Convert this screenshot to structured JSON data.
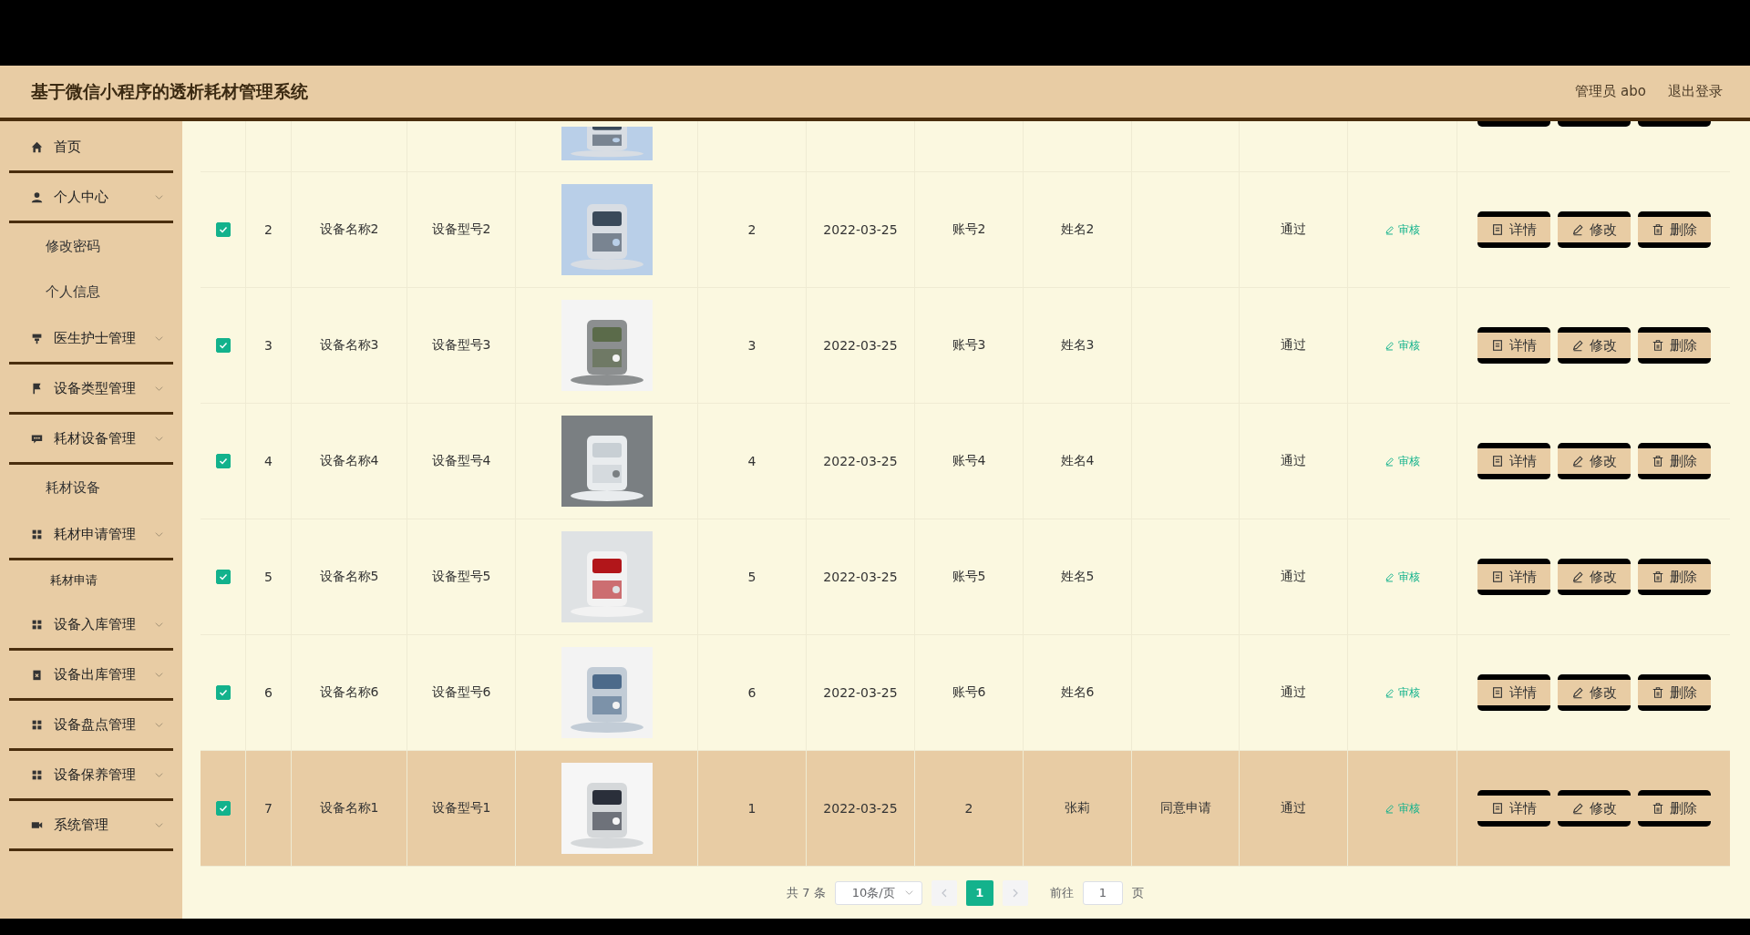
{
  "header": {
    "title": "基于微信小程序的透析耗材管理系统",
    "user": "管理员 abo",
    "logout": "退出登录"
  },
  "sidebar": {
    "items": [
      {
        "kind": "link",
        "label": "首页"
      },
      {
        "kind": "group",
        "label": "个人中心",
        "children": [
          {
            "label": "修改密码",
            "selected": false
          },
          {
            "label": "个人信息",
            "selected": false
          }
        ]
      },
      {
        "kind": "group",
        "label": "医生护士管理"
      },
      {
        "kind": "group",
        "label": "设备类型管理"
      },
      {
        "kind": "group",
        "label": "耗材设备管理",
        "children": [
          {
            "label": "耗材设备",
            "selected": false
          }
        ]
      },
      {
        "kind": "group",
        "label": "耗材申请管理",
        "children": [
          {
            "label": "耗材申请",
            "selected": true
          }
        ]
      },
      {
        "kind": "group",
        "label": "设备入库管理"
      },
      {
        "kind": "group",
        "label": "设备出库管理"
      },
      {
        "kind": "group",
        "label": "设备盘点管理"
      },
      {
        "kind": "group",
        "label": "设备保养管理"
      },
      {
        "kind": "group",
        "label": "系统管理"
      }
    ]
  },
  "table": {
    "rows": [
      {
        "kind": "partial"
      },
      {
        "kind": "item",
        "checked": true,
        "selected": false,
        "no": "2",
        "name": "设备名称2",
        "model": "设备型号2",
        "qty": "2",
        "date": "2022-03-25",
        "account": "账号2",
        "person": "姓名2",
        "status": "通过",
        "review": "审核",
        "actions": [
          "详情",
          "修改",
          "删除"
        ]
      },
      {
        "kind": "item",
        "checked": true,
        "selected": false,
        "no": "3",
        "name": "设备名称3",
        "model": "设备型号3",
        "qty": "3",
        "date": "2022-03-25",
        "account": "账号3",
        "person": "姓名3",
        "status": "通过",
        "review": "审核",
        "actions": [
          "详情",
          "修改",
          "删除"
        ]
      },
      {
        "kind": "item",
        "checked": true,
        "selected": false,
        "no": "4",
        "name": "设备名称4",
        "model": "设备型号4",
        "qty": "4",
        "date": "2022-03-25",
        "account": "账号4",
        "person": "姓名4",
        "status": "通过",
        "review": "审核",
        "actions": [
          "详情",
          "修改",
          "删除"
        ]
      },
      {
        "kind": "item",
        "checked": true,
        "selected": false,
        "no": "5",
        "name": "设备名称5",
        "model": "设备型号5",
        "qty": "5",
        "date": "2022-03-25",
        "account": "账号5",
        "person": "姓名5",
        "status": "通过",
        "review": "审核",
        "actions": [
          "详情",
          "修改",
          "删除"
        ]
      },
      {
        "kind": "item",
        "checked": true,
        "selected": false,
        "no": "6",
        "name": "设备名称6",
        "model": "设备型号6",
        "qty": "6",
        "date": "2022-03-25",
        "account": "账号6",
        "person": "姓名6",
        "status": "通过",
        "review": "审核",
        "actions": [
          "详情",
          "修改",
          "删除"
        ]
      },
      {
        "kind": "item",
        "checked": true,
        "selected": true,
        "no": "7",
        "name": "设备名称1",
        "model": "设备型号1",
        "qty": "1",
        "date": "2022-03-25",
        "account": "2",
        "person": "张莉",
        "column_10": "同意申请",
        "status": "通过",
        "review": "审核",
        "actions": [
          "详情",
          "修改",
          "删除"
        ]
      }
    ]
  },
  "pagination": {
    "total": "共 7 条",
    "page_size": "10条/页",
    "pages": [
      {
        "label": "1",
        "selected": true
      }
    ],
    "goto": "前往",
    "goto_value": "1",
    "page_unit": "页"
  }
}
